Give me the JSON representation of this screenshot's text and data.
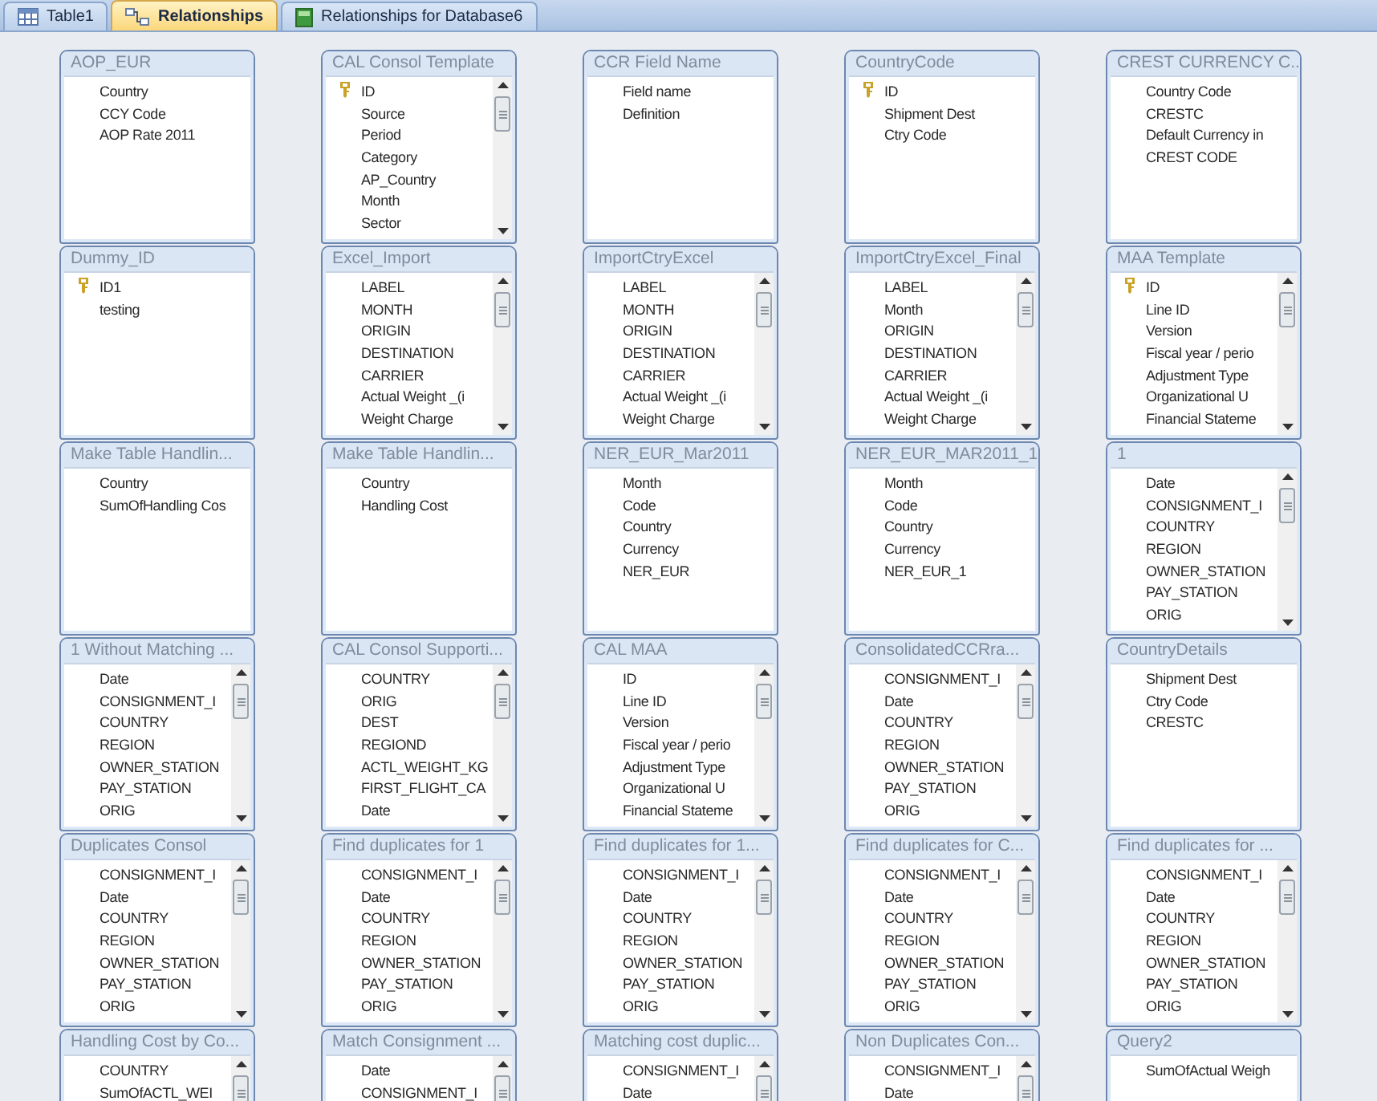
{
  "tabs": [
    {
      "label": "Table1",
      "kind": "table",
      "selected": false
    },
    {
      "label": "Relationships",
      "kind": "relationships",
      "selected": true
    },
    {
      "label": "Relationships for Database6",
      "kind": "report",
      "selected": false
    }
  ],
  "tables": [
    {
      "title": "AOP_EUR",
      "scrollbar": false,
      "fields": [
        {
          "name": "Country",
          "primary_key": false
        },
        {
          "name": "CCY Code",
          "primary_key": false
        },
        {
          "name": "AOP Rate 2011",
          "primary_key": false
        }
      ]
    },
    {
      "title": "CAL Consol Template",
      "scrollbar": true,
      "fields": [
        {
          "name": "ID",
          "primary_key": true
        },
        {
          "name": "Source",
          "primary_key": false
        },
        {
          "name": "Period",
          "primary_key": false
        },
        {
          "name": "Category",
          "primary_key": false
        },
        {
          "name": "AP_Country",
          "primary_key": false
        },
        {
          "name": "Month",
          "primary_key": false
        },
        {
          "name": "Sector",
          "primary_key": false
        }
      ]
    },
    {
      "title": "CCR Field Name",
      "scrollbar": false,
      "fields": [
        {
          "name": "Field name",
          "primary_key": false
        },
        {
          "name": "Definition",
          "primary_key": false
        }
      ]
    },
    {
      "title": "CountryCode",
      "scrollbar": false,
      "fields": [
        {
          "name": "ID",
          "primary_key": true
        },
        {
          "name": "Shipment Dest",
          "primary_key": false
        },
        {
          "name": "Ctry Code",
          "primary_key": false
        }
      ]
    },
    {
      "title": "CREST CURRENCY C...",
      "scrollbar": false,
      "fields": [
        {
          "name": "Country Code",
          "primary_key": false
        },
        {
          "name": "CRESTC",
          "primary_key": false
        },
        {
          "name": "Default Currency in",
          "primary_key": false
        },
        {
          "name": "CREST CODE",
          "primary_key": false
        }
      ]
    },
    {
      "title": "Dummy_ID",
      "scrollbar": false,
      "fields": [
        {
          "name": "ID1",
          "primary_key": true
        },
        {
          "name": "testing",
          "primary_key": false
        }
      ]
    },
    {
      "title": "Excel_Import",
      "scrollbar": true,
      "fields": [
        {
          "name": "LABEL",
          "primary_key": false
        },
        {
          "name": "MONTH",
          "primary_key": false
        },
        {
          "name": "ORIGIN",
          "primary_key": false
        },
        {
          "name": "DESTINATION",
          "primary_key": false
        },
        {
          "name": "CARRIER",
          "primary_key": false
        },
        {
          "name": "Actual Weight _(i",
          "primary_key": false
        },
        {
          "name": "Weight Charge",
          "primary_key": false
        }
      ]
    },
    {
      "title": "ImportCtryExcel",
      "scrollbar": true,
      "fields": [
        {
          "name": "LABEL",
          "primary_key": false
        },
        {
          "name": "MONTH",
          "primary_key": false
        },
        {
          "name": "ORIGIN",
          "primary_key": false
        },
        {
          "name": "DESTINATION",
          "primary_key": false
        },
        {
          "name": "CARRIER",
          "primary_key": false
        },
        {
          "name": "Actual Weight _(i",
          "primary_key": false
        },
        {
          "name": "Weight Charge",
          "primary_key": false
        }
      ]
    },
    {
      "title": "ImportCtryExcel_Final",
      "scrollbar": true,
      "fields": [
        {
          "name": "LABEL",
          "primary_key": false
        },
        {
          "name": "Month",
          "primary_key": false
        },
        {
          "name": "ORIGIN",
          "primary_key": false
        },
        {
          "name": "DESTINATION",
          "primary_key": false
        },
        {
          "name": "CARRIER",
          "primary_key": false
        },
        {
          "name": "Actual Weight _(i",
          "primary_key": false
        },
        {
          "name": "Weight Charge",
          "primary_key": false
        }
      ]
    },
    {
      "title": "MAA Template",
      "scrollbar": true,
      "fields": [
        {
          "name": "ID",
          "primary_key": true
        },
        {
          "name": "Line ID",
          "primary_key": false
        },
        {
          "name": "Version",
          "primary_key": false
        },
        {
          "name": "Fiscal year / perio",
          "primary_key": false
        },
        {
          "name": "Adjustment Type",
          "primary_key": false
        },
        {
          "name": "Organizational U",
          "primary_key": false
        },
        {
          "name": "Financial Stateme",
          "primary_key": false
        }
      ]
    },
    {
      "title": "Make Table Handlin...",
      "scrollbar": false,
      "fields": [
        {
          "name": "Country",
          "primary_key": false
        },
        {
          "name": "SumOfHandling Cos",
          "primary_key": false
        }
      ]
    },
    {
      "title": "Make Table Handlin...",
      "scrollbar": false,
      "fields": [
        {
          "name": "Country",
          "primary_key": false
        },
        {
          "name": "Handling Cost",
          "primary_key": false
        }
      ]
    },
    {
      "title": "NER_EUR_Mar2011",
      "scrollbar": false,
      "fields": [
        {
          "name": "Month",
          "primary_key": false
        },
        {
          "name": "Code",
          "primary_key": false
        },
        {
          "name": "Country",
          "primary_key": false
        },
        {
          "name": "Currency",
          "primary_key": false
        },
        {
          "name": "NER_EUR",
          "primary_key": false
        }
      ]
    },
    {
      "title": "NER_EUR_MAR2011_1",
      "scrollbar": false,
      "fields": [
        {
          "name": "Month",
          "primary_key": false
        },
        {
          "name": "Code",
          "primary_key": false
        },
        {
          "name": "Country",
          "primary_key": false
        },
        {
          "name": "Currency",
          "primary_key": false
        },
        {
          "name": "NER_EUR_1",
          "primary_key": false
        }
      ]
    },
    {
      "title": "1",
      "scrollbar": true,
      "fields": [
        {
          "name": "Date",
          "primary_key": false
        },
        {
          "name": "CONSIGNMENT_I",
          "primary_key": false
        },
        {
          "name": "COUNTRY",
          "primary_key": false
        },
        {
          "name": "REGION",
          "primary_key": false
        },
        {
          "name": "OWNER_STATION",
          "primary_key": false
        },
        {
          "name": "PAY_STATION",
          "primary_key": false
        },
        {
          "name": "ORIG",
          "primary_key": false
        }
      ]
    },
    {
      "title": "1 Without Matching ...",
      "scrollbar": true,
      "fields": [
        {
          "name": "Date",
          "primary_key": false
        },
        {
          "name": "CONSIGNMENT_I",
          "primary_key": false
        },
        {
          "name": "COUNTRY",
          "primary_key": false
        },
        {
          "name": "REGION",
          "primary_key": false
        },
        {
          "name": "OWNER_STATION",
          "primary_key": false
        },
        {
          "name": "PAY_STATION",
          "primary_key": false
        },
        {
          "name": "ORIG",
          "primary_key": false
        }
      ]
    },
    {
      "title": "CAL Consol Supporti...",
      "scrollbar": true,
      "fields": [
        {
          "name": "COUNTRY",
          "primary_key": false
        },
        {
          "name": "ORIG",
          "primary_key": false
        },
        {
          "name": "DEST",
          "primary_key": false
        },
        {
          "name": "REGIOND",
          "primary_key": false
        },
        {
          "name": "ACTL_WEIGHT_KG",
          "primary_key": false
        },
        {
          "name": "FIRST_FLIGHT_CA",
          "primary_key": false
        },
        {
          "name": "Date",
          "primary_key": false
        }
      ]
    },
    {
      "title": "CAL MAA",
      "scrollbar": true,
      "fields": [
        {
          "name": "ID",
          "primary_key": false
        },
        {
          "name": "Line ID",
          "primary_key": false
        },
        {
          "name": "Version",
          "primary_key": false
        },
        {
          "name": "Fiscal year / perio",
          "primary_key": false
        },
        {
          "name": "Adjustment Type",
          "primary_key": false
        },
        {
          "name": "Organizational U",
          "primary_key": false
        },
        {
          "name": "Financial Stateme",
          "primary_key": false
        }
      ]
    },
    {
      "title": "ConsolidatedCCRra...",
      "scrollbar": true,
      "fields": [
        {
          "name": "CONSIGNMENT_I",
          "primary_key": false
        },
        {
          "name": "Date",
          "primary_key": false
        },
        {
          "name": "COUNTRY",
          "primary_key": false
        },
        {
          "name": "REGION",
          "primary_key": false
        },
        {
          "name": "OWNER_STATION",
          "primary_key": false
        },
        {
          "name": "PAY_STATION",
          "primary_key": false
        },
        {
          "name": "ORIG",
          "primary_key": false
        }
      ]
    },
    {
      "title": "CountryDetails",
      "scrollbar": false,
      "fields": [
        {
          "name": "Shipment Dest",
          "primary_key": false
        },
        {
          "name": "Ctry Code",
          "primary_key": false
        },
        {
          "name": "CRESTC",
          "primary_key": false
        }
      ]
    },
    {
      "title": "Duplicates Consol",
      "scrollbar": true,
      "fields": [
        {
          "name": "CONSIGNMENT_I",
          "primary_key": false
        },
        {
          "name": "Date",
          "primary_key": false
        },
        {
          "name": "COUNTRY",
          "primary_key": false
        },
        {
          "name": "REGION",
          "primary_key": false
        },
        {
          "name": "OWNER_STATION",
          "primary_key": false
        },
        {
          "name": "PAY_STATION",
          "primary_key": false
        },
        {
          "name": "ORIG",
          "primary_key": false
        }
      ]
    },
    {
      "title": "Find duplicates for 1",
      "scrollbar": true,
      "fields": [
        {
          "name": "CONSIGNMENT_I",
          "primary_key": false
        },
        {
          "name": "Date",
          "primary_key": false
        },
        {
          "name": "COUNTRY",
          "primary_key": false
        },
        {
          "name": "REGION",
          "primary_key": false
        },
        {
          "name": "OWNER_STATION",
          "primary_key": false
        },
        {
          "name": "PAY_STATION",
          "primary_key": false
        },
        {
          "name": "ORIG",
          "primary_key": false
        }
      ]
    },
    {
      "title": "Find duplicates for 1...",
      "scrollbar": true,
      "fields": [
        {
          "name": "CONSIGNMENT_I",
          "primary_key": false
        },
        {
          "name": "Date",
          "primary_key": false
        },
        {
          "name": "COUNTRY",
          "primary_key": false
        },
        {
          "name": "REGION",
          "primary_key": false
        },
        {
          "name": "OWNER_STATION",
          "primary_key": false
        },
        {
          "name": "PAY_STATION",
          "primary_key": false
        },
        {
          "name": "ORIG",
          "primary_key": false
        }
      ]
    },
    {
      "title": "Find duplicates for C...",
      "scrollbar": true,
      "fields": [
        {
          "name": "CONSIGNMENT_I",
          "primary_key": false
        },
        {
          "name": "Date",
          "primary_key": false
        },
        {
          "name": "COUNTRY",
          "primary_key": false
        },
        {
          "name": "REGION",
          "primary_key": false
        },
        {
          "name": "OWNER_STATION",
          "primary_key": false
        },
        {
          "name": "PAY_STATION",
          "primary_key": false
        },
        {
          "name": "ORIG",
          "primary_key": false
        }
      ]
    },
    {
      "title": "Find duplicates for ...",
      "scrollbar": true,
      "fields": [
        {
          "name": "CONSIGNMENT_I",
          "primary_key": false
        },
        {
          "name": "Date",
          "primary_key": false
        },
        {
          "name": "COUNTRY",
          "primary_key": false
        },
        {
          "name": "REGION",
          "primary_key": false
        },
        {
          "name": "OWNER_STATION",
          "primary_key": false
        },
        {
          "name": "PAY_STATION",
          "primary_key": false
        },
        {
          "name": "ORIG",
          "primary_key": false
        }
      ]
    },
    {
      "title": "Handling Cost by Co...",
      "scrollbar": true,
      "fields": [
        {
          "name": "COUNTRY",
          "primary_key": false
        },
        {
          "name": "SumOfACTL_WEI",
          "primary_key": false
        }
      ]
    },
    {
      "title": "Match Consignment ...",
      "scrollbar": true,
      "fields": [
        {
          "name": "Date",
          "primary_key": false
        },
        {
          "name": "CONSIGNMENT_I",
          "primary_key": false
        }
      ]
    },
    {
      "title": "Matching cost duplic...",
      "scrollbar": true,
      "fields": [
        {
          "name": "CONSIGNMENT_I",
          "primary_key": false
        },
        {
          "name": "Date",
          "primary_key": false
        }
      ]
    },
    {
      "title": "Non Duplicates Con...",
      "scrollbar": true,
      "fields": [
        {
          "name": "CONSIGNMENT_I",
          "primary_key": false
        },
        {
          "name": "Date",
          "primary_key": false
        }
      ]
    },
    {
      "title": "Query2",
      "scrollbar": false,
      "fields": [
        {
          "name": "SumOfActual Weigh",
          "primary_key": false
        }
      ]
    }
  ]
}
